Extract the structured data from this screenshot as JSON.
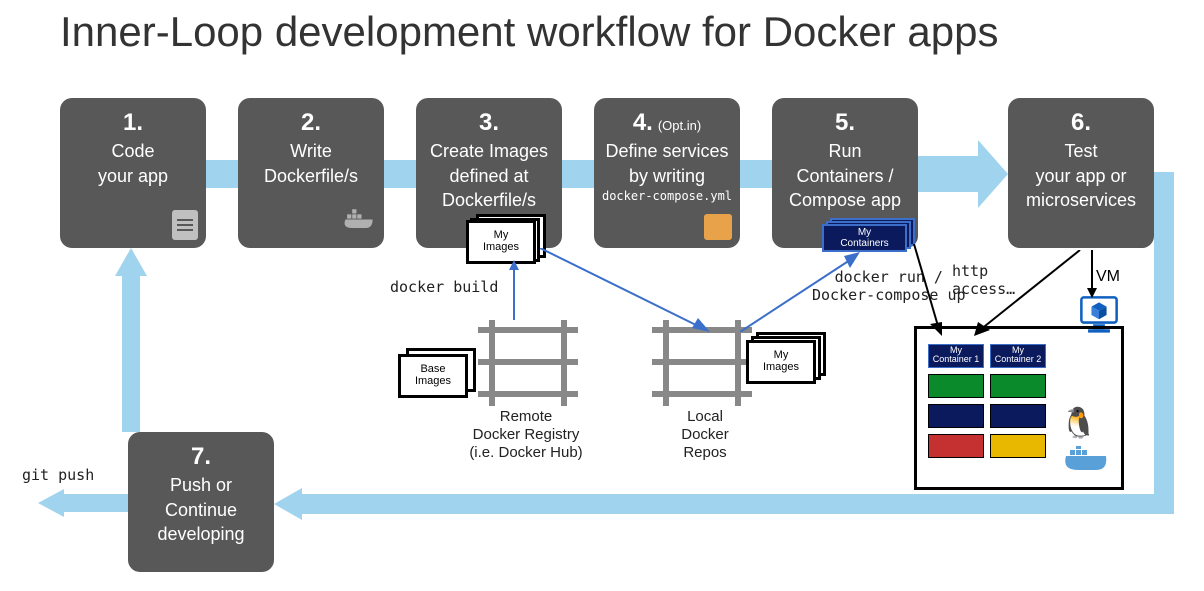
{
  "title": "Inner-Loop development workflow for Docker apps",
  "steps": {
    "s1": {
      "num": "1.",
      "l1": "Code",
      "l2": "your app"
    },
    "s2": {
      "num": "2.",
      "l1": "Write",
      "l2": "Dockerfile/s"
    },
    "s3": {
      "num": "3.",
      "l1": "Create Images",
      "l2": "defined at",
      "l3": "Dockerfile/s"
    },
    "s4": {
      "num": "4.",
      "opt": "(Opt.in)",
      "l1": "Define services",
      "l2": "by writing",
      "yml": "docker-compose.yml"
    },
    "s5": {
      "num": "5.",
      "l1": "Run",
      "l2": "Containers /",
      "l3": "Compose app"
    },
    "s6": {
      "num": "6.",
      "l1": "Test",
      "l2": "your app or",
      "l3": "microservices"
    },
    "s7": {
      "num": "7.",
      "l1": "Push or",
      "l2": "Continue",
      "l3": "developing"
    }
  },
  "labels": {
    "docker_build": "docker build",
    "docker_run": "docker run /\nDocker-compose up",
    "http_access": "http\naccess…",
    "git_push": "git push",
    "vm": "VM"
  },
  "cards": {
    "my_images": "My\nImages",
    "base_images": "Base\nImages",
    "my_containers": "My\nContainers",
    "my_container1": "My\nContainer 1",
    "my_container2": "My\nContainer 2"
  },
  "captions": {
    "remote": "Remote\nDocker Registry\n(i.e. Docker Hub)",
    "local": "Local\nDocker\nRepos"
  }
}
